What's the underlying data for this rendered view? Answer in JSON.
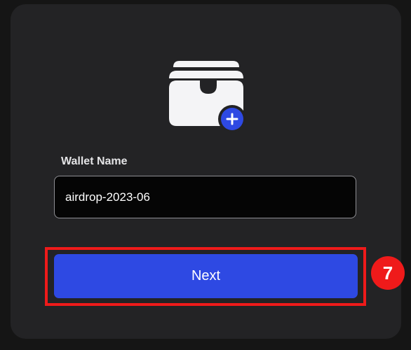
{
  "form": {
    "wallet_name_label": "Wallet Name",
    "wallet_name_value": "airdrop-2023-06"
  },
  "actions": {
    "next_label": "Next"
  },
  "annotation": {
    "step_number": "7"
  },
  "icons": {
    "wallet": "wallet-icon",
    "add": "plus-icon"
  },
  "colors": {
    "card_background": "#232325",
    "primary_button": "#2e49e3",
    "highlight": "#ef1a1a",
    "input_background": "#050505"
  }
}
